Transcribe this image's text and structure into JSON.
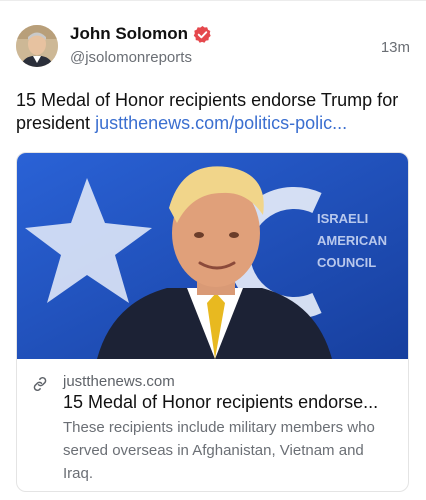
{
  "author": {
    "display_name": "John Solomon",
    "handle": "@jsolomonreports",
    "verified": true,
    "verified_color": "#e5484d"
  },
  "post": {
    "timestamp": "13m",
    "text": "15 Medal of Honor recipients endorse Trump for president",
    "link_text": "justthenews.com/politics-polic..."
  },
  "link_card": {
    "image_icon": "news-photo",
    "background_text": [
      "ISRAELI",
      "AMERICAN",
      "COUNCIL"
    ],
    "domain": "justthenews.com",
    "title": "15 Medal of Honor recipients endorse...",
    "description": "These recipients include military members who served overseas in Afghanistan, Vietnam and Iraq."
  },
  "colors": {
    "link": "#3b6fd0",
    "muted": "#6b6f75",
    "card_backdrop": "#1f57c9"
  }
}
